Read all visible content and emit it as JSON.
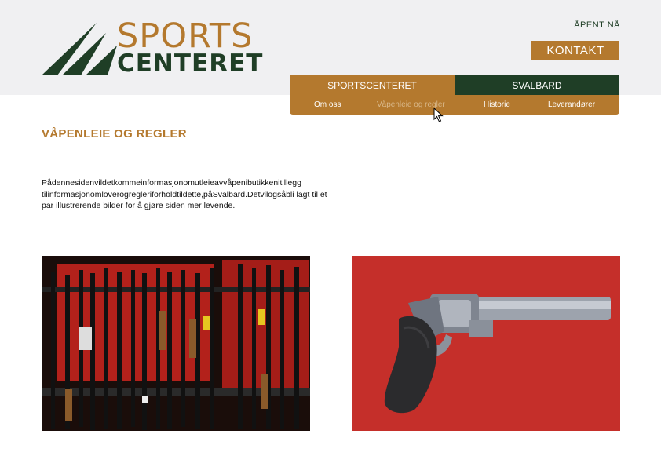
{
  "brand": {
    "line1": "SPORTS",
    "line2": "CENTERET",
    "color_primary": "#b4792e",
    "color_dark": "#1f3e26"
  },
  "header": {
    "open_now": "ÅPENT NÅ",
    "contact_label": "KONTAKT"
  },
  "nav": {
    "tabs": [
      {
        "label": "SPORTSCENTERET"
      },
      {
        "label": "SVALBARD"
      }
    ],
    "sub_items": [
      {
        "label": "Om oss"
      },
      {
        "label": "Våpenleie og regler",
        "active": true
      },
      {
        "label": "Historie"
      },
      {
        "label": "Leverandører"
      }
    ]
  },
  "main": {
    "title": "VÅPENLEIE OG REGLER",
    "intro": "Pådennesidenvildetkommeinformasjonomutleieavvåpenibutikkenitillegg tilinformasjonomloverogregleriforholdtildette,påSvalbard.Detvilogsåbli lagt til et par illustrerende bilder for å gjøre siden mer levende."
  },
  "images": [
    {
      "name": "gun-rack-photo"
    },
    {
      "name": "revolver-photo"
    }
  ]
}
